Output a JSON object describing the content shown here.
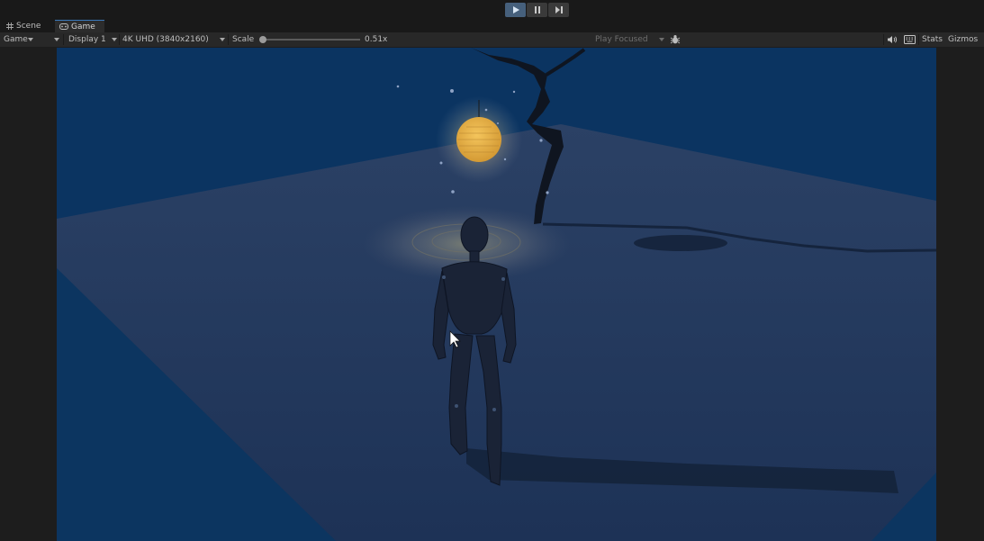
{
  "play_controls": {
    "play": "play-button",
    "pause": "pause-button",
    "step": "step-button"
  },
  "tabs": [
    {
      "label": "Scene",
      "icon": "scene-grid-icon"
    },
    {
      "label": "Game",
      "icon": "gamepad-icon"
    }
  ],
  "toolbar": {
    "view_mode": "Game",
    "display": "Display 1",
    "resolution": "4K UHD (3840x2160)",
    "scale_label": "Scale",
    "scale_value_text": "0.51x",
    "scale_fraction": 0.03,
    "play_mode": "Play Focused",
    "stats": "Stats",
    "gizmos": "Gizmos"
  },
  "colors": {
    "accent": "#3a79bb",
    "sky": "#0b3563",
    "ground": "#1f3557",
    "lantern": "#e0b04a"
  }
}
